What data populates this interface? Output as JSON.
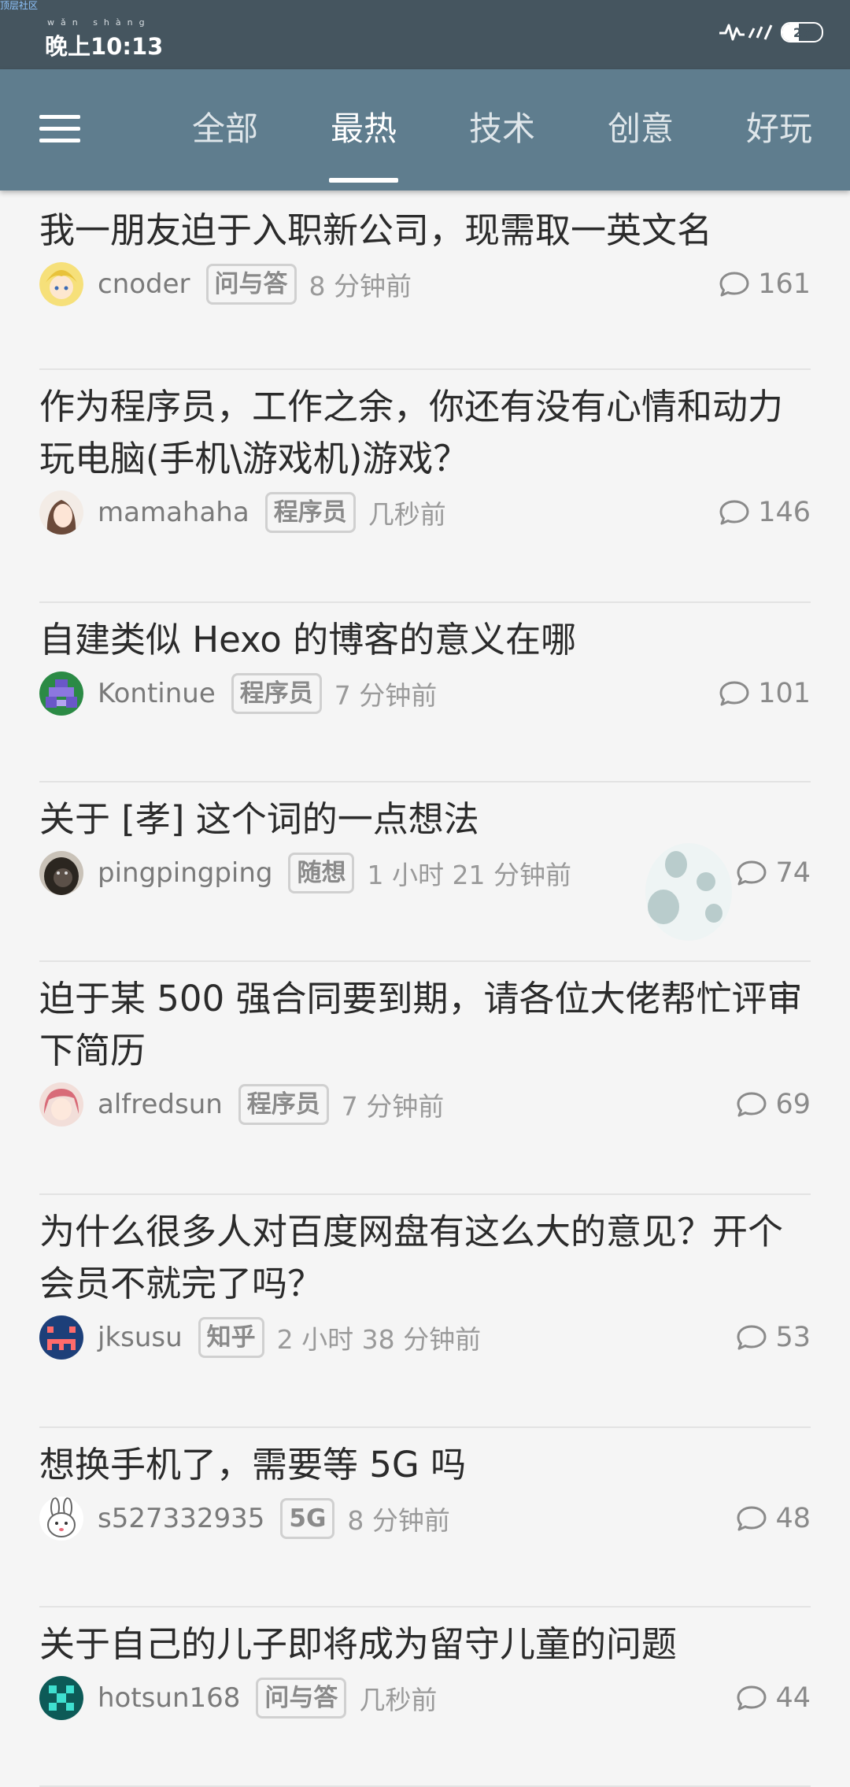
{
  "status_bar": {
    "corner_label": "顶层社区",
    "time_ruby": "wǎn shàng",
    "time": "晚上10:13",
    "battery": "27"
  },
  "nav": {
    "tabs": [
      {
        "label": "全部",
        "active": false
      },
      {
        "label": "最热",
        "active": true
      },
      {
        "label": "技术",
        "active": false
      },
      {
        "label": "创意",
        "active": false
      },
      {
        "label": "好玩",
        "active": false
      }
    ]
  },
  "topics": [
    {
      "title": "我一朋友迫于入职新公司，现需取一英文名",
      "author": "cnoder",
      "tag": "问与答",
      "ago": "8 分钟前",
      "replies": "161",
      "avatar": "blonde-anime-avatar"
    },
    {
      "title": "作为程序员，工作之余，你还有没有心情和动力玩电脑(手机\\游戏机)游戏？",
      "author": "mamahaha",
      "tag": "程序员",
      "ago": "几秒前",
      "replies": "146",
      "avatar": "anime-girl-avatar"
    },
    {
      "title": "自建类似 Hexo 的博客的意义在哪",
      "author": "Kontinue",
      "tag": "程序员",
      "ago": "7 分钟前",
      "replies": "101",
      "avatar": "pixel-purple-avatar"
    },
    {
      "title": "关于 [孝] 这个词的一点想法",
      "author": "pingpingping",
      "tag": "随想",
      "ago": "1 小时 21 分钟前",
      "replies": "74",
      "avatar": "gorilla-avatar"
    },
    {
      "title": "迫于某 500 强合同要到期，请各位大佬帮忙评审下简历",
      "author": "alfredsun",
      "tag": "程序员",
      "ago": "7 分钟前",
      "replies": "69",
      "avatar": "pink-hair-anime-avatar"
    },
    {
      "title": "为什么很多人对百度网盘有这么大的意见？开个会员不就完了吗？",
      "author": "jksusu",
      "tag": "知乎",
      "ago": "2 小时 38 分钟前",
      "replies": "53",
      "avatar": "pixel-navy-avatar"
    },
    {
      "title": "想换手机了，需要等 5G 吗",
      "author": "s527332935",
      "tag": "5G",
      "ago": "8 分钟前",
      "replies": "48",
      "avatar": "rabbit-avatar"
    },
    {
      "title": "关于自己的儿子即将成为留守儿童的问题",
      "author": "hotsun168",
      "tag": "问与答",
      "ago": "几秒前",
      "replies": "44",
      "avatar": "pixel-teal-avatar"
    }
  ],
  "colors": {
    "nav_bg": "#5f7d8e",
    "status_bg": "#45555f",
    "page_bg": "#f5f5f5"
  }
}
